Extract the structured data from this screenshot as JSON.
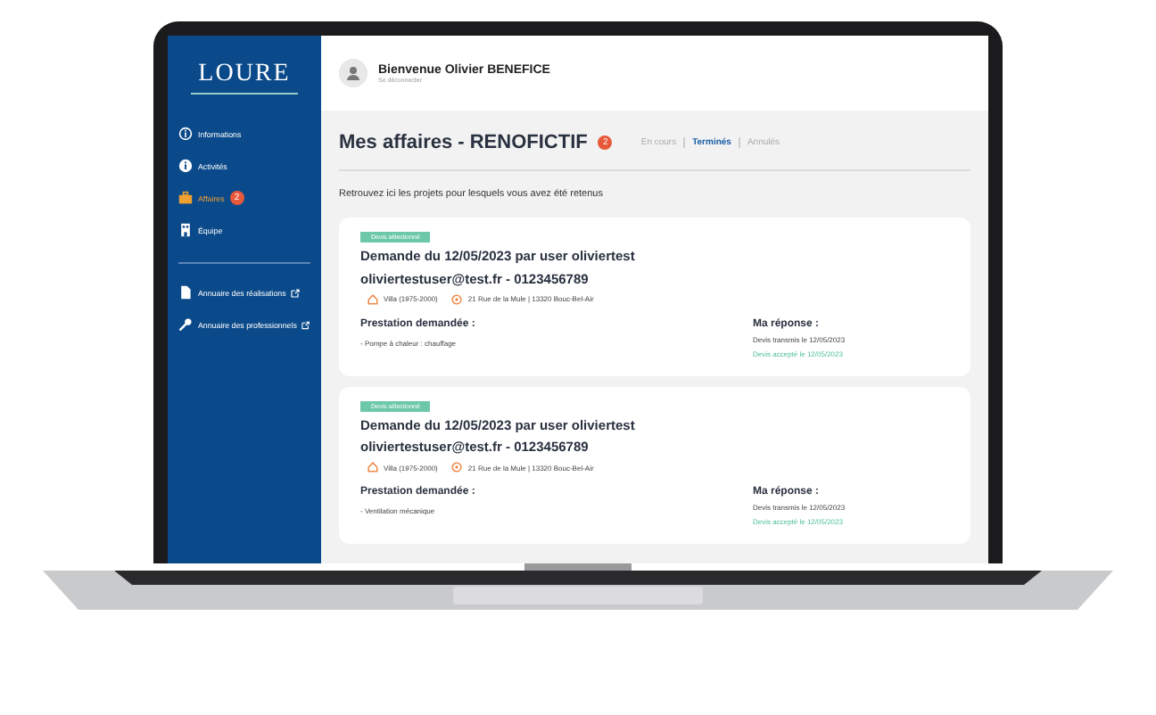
{
  "sidebar": {
    "logo": "LOURE",
    "items": [
      {
        "label": "Informations",
        "selected": false
      },
      {
        "label": "Activités",
        "selected": false
      },
      {
        "label": "Affaires",
        "selected": true,
        "badge": "2"
      },
      {
        "label": "Équipe",
        "selected": false
      }
    ],
    "links": [
      {
        "label": "Annuaire des réalisations"
      },
      {
        "label": "Annuaire des professionnels"
      }
    ]
  },
  "header": {
    "welcome": "Bienvenue Olivier BENEFICE",
    "logout": "Se déconnecter"
  },
  "page": {
    "title": "Mes affaires - RENOFICTIF",
    "badge": "2",
    "tabs": [
      {
        "label": "En cours",
        "selected": false
      },
      {
        "label": "Terminés",
        "selected": true
      },
      {
        "label": "Annulés",
        "selected": false
      }
    ],
    "intro": "Retrouvez ici les projets pour lesquels vous avez été retenus",
    "cards": [
      {
        "tag": "Devis sélectionné",
        "title": "Demande du 12/05/2023 par user oliviertest",
        "contact": "oliviertestuser@test.fr - 0123456789",
        "housing": "Villa (1975-2000)",
        "address": "21 Rue de la Mule | 13320 Bouc-Bel-Air",
        "service_heading": "Prestation demandée :",
        "service": "- Pompe à chaleur : chauffage",
        "response_heading": "Ma réponse :",
        "responses": [
          {
            "text": "Devis transmis le 12/05/2023",
            "kind": "sent"
          },
          {
            "text": "Devis accepté le 12/05/2023",
            "kind": "accepted"
          }
        ]
      },
      {
        "tag": "Devis sélectionné",
        "title": "Demande du 12/05/2023 par user oliviertest",
        "contact": "oliviertestuser@test.fr - 0123456789",
        "housing": "Villa (1975-2000)",
        "address": "21 Rue de la Mule | 13320 Bouc-Bel-Air",
        "service_heading": "Prestation demandée :",
        "service": "- Ventilation mécanique",
        "response_heading": "Ma réponse :",
        "responses": [
          {
            "text": "Devis transmis le 12/05/2023",
            "kind": "sent"
          },
          {
            "text": "Devis accepté le 12/05/2023",
            "kind": "accepted"
          }
        ]
      }
    ]
  }
}
